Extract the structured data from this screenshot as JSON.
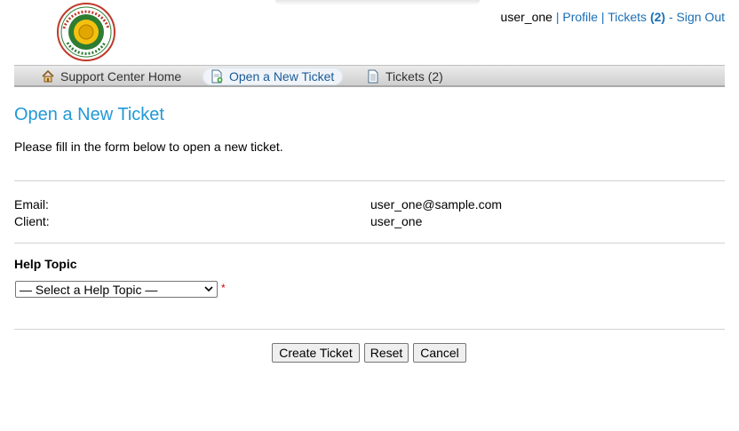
{
  "header": {
    "logo_alt": "MINDANAO STATE UNIVERSITY GEN. SANTOS CITY",
    "user": {
      "username": "user_one",
      "separator": " | ",
      "profile": "Profile",
      "tickets_label": "Tickets",
      "tickets_count": "(2)",
      "dash": " - ",
      "sign_out": "Sign Out"
    }
  },
  "nav": {
    "items": [
      {
        "label": "Support Center Home",
        "icon": "home-icon"
      },
      {
        "label": "Open a New Ticket",
        "icon": "new-ticket-icon",
        "active": true
      },
      {
        "label": "Tickets (2)",
        "icon": "tickets-icon"
      }
    ]
  },
  "main": {
    "title": "Open a New Ticket",
    "intro": "Please fill in the form below to open a new ticket.",
    "info": [
      {
        "label": "Email:",
        "value": "user_one@sample.com"
      },
      {
        "label": "Client:",
        "value": "user_one"
      }
    ],
    "help_topic": {
      "label": "Help Topic",
      "selected": "— Select a Help Topic —",
      "required_mark": "*"
    },
    "buttons": {
      "create": "Create Ticket",
      "reset": "Reset",
      "cancel": "Cancel"
    }
  },
  "colors": {
    "accent": "#2299d6",
    "link": "#1a6fb5",
    "required": "#dd0000"
  }
}
